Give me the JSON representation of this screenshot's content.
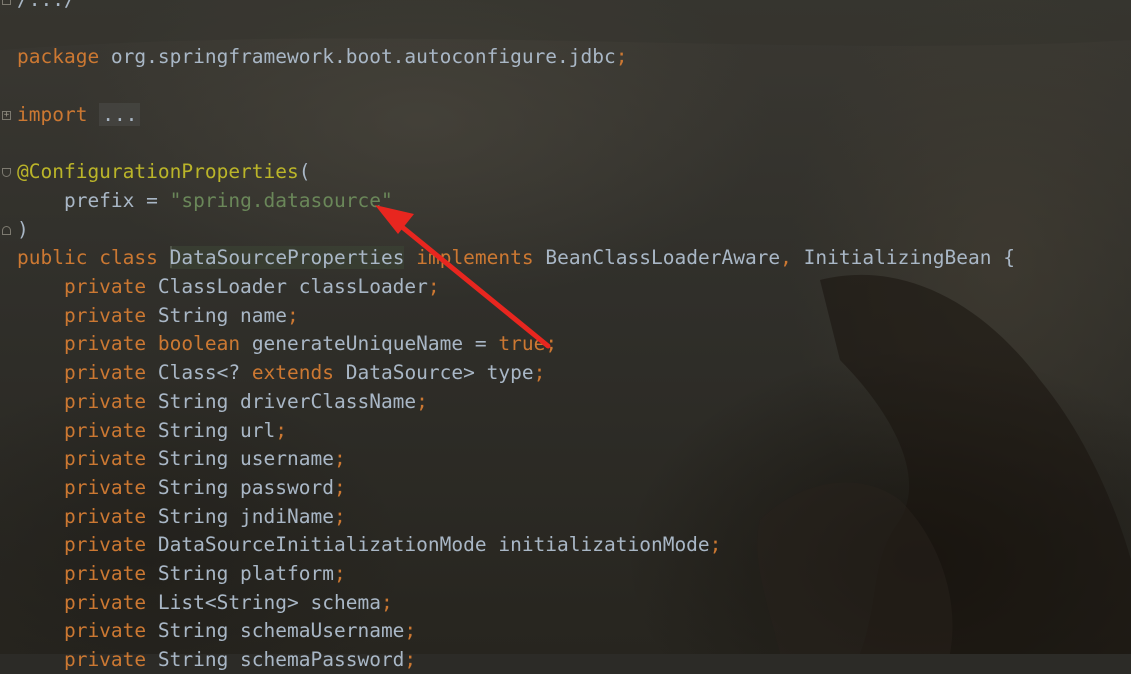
{
  "editor": {
    "lines": [
      {
        "parts": [
          {
            "t": "/.../",
            "c": "plain"
          }
        ]
      },
      {
        "parts": []
      },
      {
        "parts": [
          {
            "t": "package",
            "c": "kw"
          },
          {
            "t": " org.springframework.boot.autoconfigure.jdbc",
            "c": "plain"
          },
          {
            "t": ";",
            "c": "kw"
          }
        ]
      },
      {
        "parts": []
      },
      {
        "parts": [
          {
            "t": "import",
            "c": "kw"
          },
          {
            "t": " ",
            "c": "plain"
          },
          {
            "t": "...",
            "c": "folded"
          }
        ]
      },
      {
        "parts": []
      },
      {
        "parts": [
          {
            "t": "@ConfigurationProperties",
            "c": "ann"
          },
          {
            "t": "(",
            "c": "plain"
          }
        ]
      },
      {
        "parts": [
          {
            "t": "    prefix = ",
            "c": "plain"
          },
          {
            "t": "\"spring.datasource\"",
            "c": "str"
          }
        ]
      },
      {
        "parts": [
          {
            "t": ")",
            "c": "plain"
          }
        ]
      },
      {
        "parts": [
          {
            "t": "public",
            "c": "kw"
          },
          {
            "t": " ",
            "c": "plain"
          },
          {
            "t": "class",
            "c": "kw"
          },
          {
            "t": " ",
            "c": "plain"
          },
          {
            "t": "DataSourceProperties",
            "c": "cls-hl",
            "caret": true
          },
          {
            "t": " ",
            "c": "plain"
          },
          {
            "t": "implements",
            "c": "kw"
          },
          {
            "t": " BeanClassLoaderAware",
            "c": "plain"
          },
          {
            "t": ",",
            "c": "kw"
          },
          {
            "t": " InitializingBean {",
            "c": "plain"
          }
        ]
      },
      {
        "parts": [
          {
            "t": "    private",
            "c": "kw"
          },
          {
            "t": " ClassLoader classLoader",
            "c": "plain"
          },
          {
            "t": ";",
            "c": "kw"
          }
        ]
      },
      {
        "parts": [
          {
            "t": "    private",
            "c": "kw"
          },
          {
            "t": " String name",
            "c": "plain"
          },
          {
            "t": ";",
            "c": "kw"
          }
        ]
      },
      {
        "parts": [
          {
            "t": "    private",
            "c": "kw"
          },
          {
            "t": " ",
            "c": "plain"
          },
          {
            "t": "boolean",
            "c": "kw"
          },
          {
            "t": " generateUniqueName = ",
            "c": "plain"
          },
          {
            "t": "true",
            "c": "kw"
          },
          {
            "t": ";",
            "c": "kw"
          }
        ]
      },
      {
        "parts": [
          {
            "t": "    private",
            "c": "kw"
          },
          {
            "t": " Class<? ",
            "c": "plain"
          },
          {
            "t": "extends",
            "c": "kw"
          },
          {
            "t": " DataSource> type",
            "c": "plain"
          },
          {
            "t": ";",
            "c": "kw"
          }
        ]
      },
      {
        "parts": [
          {
            "t": "    private",
            "c": "kw"
          },
          {
            "t": " String driverClassName",
            "c": "plain"
          },
          {
            "t": ";",
            "c": "kw"
          }
        ]
      },
      {
        "parts": [
          {
            "t": "    private",
            "c": "kw"
          },
          {
            "t": " String url",
            "c": "plain"
          },
          {
            "t": ";",
            "c": "kw"
          }
        ]
      },
      {
        "parts": [
          {
            "t": "    private",
            "c": "kw"
          },
          {
            "t": " String username",
            "c": "plain"
          },
          {
            "t": ";",
            "c": "kw"
          }
        ]
      },
      {
        "parts": [
          {
            "t": "    private",
            "c": "kw"
          },
          {
            "t": " String password",
            "c": "plain"
          },
          {
            "t": ";",
            "c": "kw"
          }
        ]
      },
      {
        "parts": [
          {
            "t": "    private",
            "c": "kw"
          },
          {
            "t": " String jndiName",
            "c": "plain"
          },
          {
            "t": ";",
            "c": "kw"
          }
        ]
      },
      {
        "parts": [
          {
            "t": "    private",
            "c": "kw"
          },
          {
            "t": " DataSourceInitializationMode initializationMode",
            "c": "plain"
          },
          {
            "t": ";",
            "c": "kw"
          }
        ]
      },
      {
        "parts": [
          {
            "t": "    private",
            "c": "kw"
          },
          {
            "t": " String platform",
            "c": "plain"
          },
          {
            "t": ";",
            "c": "kw"
          }
        ]
      },
      {
        "parts": [
          {
            "t": "    private",
            "c": "kw"
          },
          {
            "t": " List<String> schema",
            "c": "plain"
          },
          {
            "t": ";",
            "c": "kw"
          }
        ]
      },
      {
        "parts": [
          {
            "t": "    private",
            "c": "kw"
          },
          {
            "t": " String schemaUsername",
            "c": "plain"
          },
          {
            "t": ";",
            "c": "kw"
          }
        ]
      },
      {
        "parts": [
          {
            "t": "    private",
            "c": "kw"
          },
          {
            "t": " String schemaPassword",
            "c": "plain"
          },
          {
            "t": ";",
            "c": "kw"
          }
        ]
      }
    ],
    "fold_markers": [
      {
        "line": 0,
        "kind": "close",
        "glyph": ""
      },
      {
        "line": 4,
        "kind": "plus",
        "glyph": "+"
      },
      {
        "line": 6,
        "kind": "open",
        "glyph": ""
      },
      {
        "line": 8,
        "kind": "close",
        "glyph": ""
      }
    ]
  },
  "annotation": {
    "arrow_color": "#e8261f",
    "arrow_icon": "red-arrow-icon"
  },
  "colors": {
    "keyword": "#cc7832",
    "annotation": "#bbb529",
    "string": "#6a8759",
    "text": "#a9b7c6"
  }
}
